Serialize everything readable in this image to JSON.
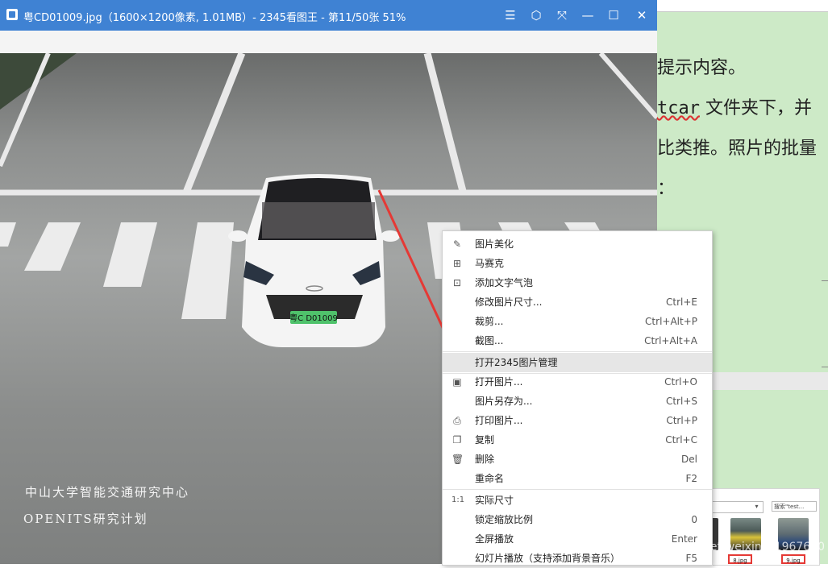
{
  "window": {
    "title": "粤CD01009.jpg（1600×1200像素, 1.01MB）- 2345看图王 - 第11/50张 51%",
    "controls": [
      "menu-icon",
      "skin-icon",
      "fullscreen-icon",
      "minimize-icon",
      "maximize-icon",
      "close-icon"
    ]
  },
  "photo": {
    "watermark_line1": "中山大学智能交通研究中心",
    "watermark_line2": "OPENITS研究计划",
    "plate": "粤C D01009"
  },
  "document": {
    "lines": [
      {
        "text": "提示内容。"
      },
      {
        "pre": "",
        "underlined": "tcar",
        "post": " 文件夹下，并"
      },
      {
        "text": "比类推。照片的批量"
      },
      {
        "text": "："
      }
    ]
  },
  "explorer": {
    "search_placeholder": "搜索\"test...",
    "file1": "8.jpg",
    "file2": "9.jpg"
  },
  "context_menu": {
    "items": [
      {
        "label": "图片美化",
        "shortcut": "",
        "icon": "edit-icon"
      },
      {
        "label": "马赛克",
        "shortcut": "",
        "icon": "mosaic-icon"
      },
      {
        "label": "添加文字气泡",
        "shortcut": "",
        "icon": "text-bubble-icon"
      },
      {
        "label": "修改图片尺寸...",
        "shortcut": "Ctrl+E",
        "icon": ""
      },
      {
        "label": "裁剪...",
        "shortcut": "Ctrl+Alt+P",
        "icon": ""
      },
      {
        "label": "截图...",
        "shortcut": "Ctrl+Alt+A",
        "icon": ""
      },
      {
        "label": "打开2345图片管理",
        "shortcut": "",
        "icon": ""
      },
      {
        "label": "打开图片...",
        "shortcut": "Ctrl+O",
        "icon": "image-icon"
      },
      {
        "label": "图片另存为...",
        "shortcut": "Ctrl+S",
        "icon": ""
      },
      {
        "label": "打印图片...",
        "shortcut": "Ctrl+P",
        "icon": "printer-icon"
      },
      {
        "label": "复制",
        "shortcut": "Ctrl+C",
        "icon": "copy-icon"
      },
      {
        "label": "删除",
        "shortcut": "Del",
        "icon": "trash-icon"
      },
      {
        "label": "重命名",
        "shortcut": "F2",
        "icon": ""
      },
      {
        "label": "实际尺寸",
        "shortcut": "",
        "icon": "actual-size-icon"
      },
      {
        "label": "锁定缩放比例",
        "shortcut": "0",
        "icon": ""
      },
      {
        "label": "全屏播放",
        "shortcut": "Enter",
        "icon": ""
      },
      {
        "label": "幻灯片播放（支持添加背景音乐）",
        "shortcut": "F5",
        "icon": ""
      }
    ],
    "highlighted_index": 6,
    "highlight_color": "#e6e6e6"
  },
  "blog_watermark": "https://blog.csdn.net/weixin_41967600",
  "colors": {
    "titlebar": "#3f82d3",
    "document_bg": "#cdeac7",
    "annotation_arrow": "#e53935",
    "plate_green": "#4fc26b"
  }
}
